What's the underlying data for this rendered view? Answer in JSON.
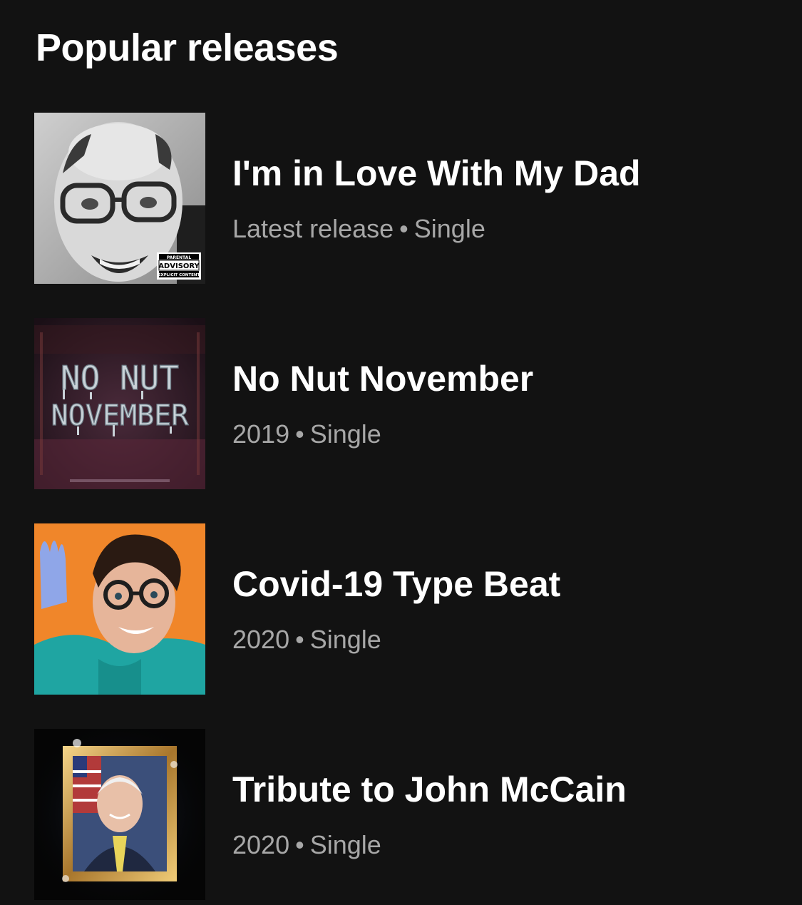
{
  "section": {
    "title": "Popular releases"
  },
  "releases": [
    {
      "title": "I'm in Love With My Dad",
      "meta_left": "Latest release",
      "separator": "•",
      "type": "Single",
      "cover_icon": "black-and-white-portrait-cover",
      "advisory": [
        "PARENTAL",
        "ADVISORY",
        "EXPLICIT CONTENT"
      ]
    },
    {
      "title": "No Nut November",
      "meta_left": "2019",
      "separator": "•",
      "type": "Single",
      "cover_icon": "dripping-text-dark-red-cover",
      "cover_text": [
        "NO NUT",
        "NOVEMBER"
      ]
    },
    {
      "title": "Covid-19 Type Beat",
      "meta_left": "2020",
      "separator": "•",
      "type": "Single",
      "cover_icon": "orange-teal-portrait-cover"
    },
    {
      "title": "Tribute to John McCain",
      "meta_left": "2020",
      "separator": "•",
      "type": "Single",
      "cover_icon": "gold-frame-portrait-cover"
    }
  ],
  "colors": {
    "background": "#121212",
    "title": "#ffffff",
    "meta": "#a7a7a7"
  }
}
